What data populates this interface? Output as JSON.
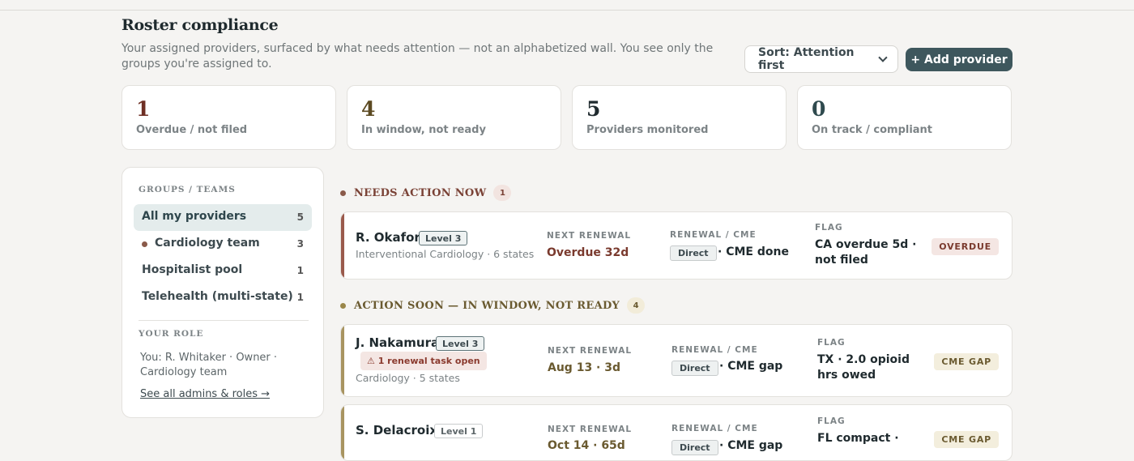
{
  "header": {
    "title": "Roster compliance",
    "description": "Your assigned providers, surfaced by what needs attention — not an alphabetized wall. You see only the groups you're assigned to.",
    "sort_label": "Sort: Attention first",
    "add_label": "+ Add provider"
  },
  "stats": [
    {
      "value": "1",
      "label": "Overdue / not filed",
      "color": "#6e2f24"
    },
    {
      "value": "4",
      "label": "In window, not ready",
      "color": "#5c4a22"
    },
    {
      "value": "5",
      "label": "Providers monitored",
      "color": "#1f2a2e"
    },
    {
      "value": "0",
      "label": "On track / compliant",
      "color": "#2f4a4e"
    }
  ],
  "sidebar": {
    "groups_heading": "GROUPS / TEAMS",
    "items": [
      {
        "label": "All my providers",
        "count": "5"
      },
      {
        "label": "Cardiology team",
        "count": "3"
      },
      {
        "label": "Hospitalist pool",
        "count": "1"
      },
      {
        "label": "Telehealth (multi-state)",
        "count": "1"
      }
    ],
    "role_heading": "YOUR ROLE",
    "role_text": "You: R. Whitaker · Owner · Cardiology team",
    "role_link": "See all admins & roles →"
  },
  "sections": {
    "now": {
      "title": "NEEDS ACTION NOW",
      "count": "1",
      "color": "#7a4236"
    },
    "soon": {
      "title": "ACTION SOON — IN WINDOW, NOT READY",
      "count": "4",
      "color": "#7a6a3a"
    }
  },
  "labels": {
    "next_renewal": "NEXT RENEWAL",
    "renewal_cme": "RENEWAL / CME",
    "flag": "FLAG"
  },
  "providers": [
    {
      "name": "R. Okafor",
      "level": "Level 3",
      "specialty": "Interventional Cardiology · 6 states",
      "next_renewal": "Overdue 32d",
      "renewal_type": "Direct",
      "cme": "· CME done",
      "flag": "CA overdue 5d · not filed",
      "status": "OVERDUE"
    },
    {
      "name": "J. Nakamura",
      "level": "Level 3",
      "task": "⚠ 1 renewal task open",
      "specialty": "Cardiology · 5 states",
      "next_renewal": "Aug 13 · 3d",
      "renewal_type": "Direct",
      "cme": "· CME gap",
      "flag": "TX · 2.0 opioid hrs owed",
      "status": "CME GAP"
    },
    {
      "name": "S. Delacroix",
      "level": "Level 1",
      "next_renewal": "Oct 14 · 65d",
      "renewal_type": "Direct",
      "cme": "· CME gap",
      "flag": "FL compact ·",
      "status": "CME GAP"
    }
  ]
}
